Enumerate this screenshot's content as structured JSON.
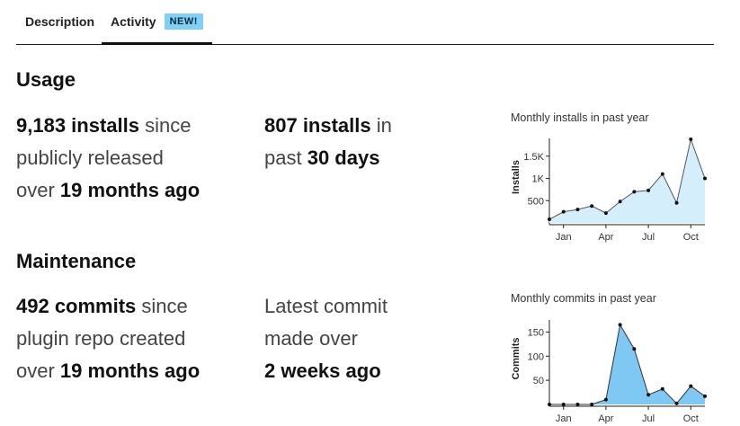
{
  "tabs": {
    "description_label": "Description",
    "activity_label": "Activity",
    "badge_label": "NEW!"
  },
  "usage": {
    "title": "Usage",
    "stat1": {
      "count": "9,183 installs",
      "t1": "since",
      "t2": "publicly released",
      "t3": "over",
      "period": "19 months ago"
    },
    "stat2": {
      "count": "807 installs",
      "t1": "in",
      "t2": "past",
      "period": "30 days"
    }
  },
  "maintenance": {
    "title": "Maintenance",
    "stat1": {
      "count": "492 commits",
      "t1": "since",
      "t2": "plugin repo created",
      "t3": "over",
      "period": "19 months ago"
    },
    "stat2": {
      "t1": "Latest commit",
      "t2": "made",
      "t3": "over",
      "period": "2 weeks ago"
    }
  },
  "chart_data": [
    {
      "type": "area",
      "title": "Monthly installs in past year",
      "ylabel": "Installs",
      "xticks": [
        "Jan",
        "Apr",
        "Jul",
        "Oct"
      ],
      "yticks": [
        500,
        1000,
        1500
      ],
      "ytick_labels": [
        "500",
        "1K",
        "1.5K"
      ],
      "ylim": [
        0,
        1900
      ],
      "values": [
        80,
        250,
        300,
        380,
        220,
        480,
        700,
        730,
        1100,
        450,
        1880,
        1000
      ],
      "fill_color": "#d4eefb",
      "line_color": "#555555"
    },
    {
      "type": "area",
      "title": "Monthly commits in past year",
      "ylabel": "Commits",
      "xticks": [
        "Jan",
        "Apr",
        "Jul",
        "Oct"
      ],
      "yticks": [
        50,
        100,
        150
      ],
      "ytick_labels": [
        "50",
        "100",
        "150"
      ],
      "ylim": [
        0,
        175
      ],
      "values": [
        0,
        0,
        0,
        0,
        10,
        165,
        115,
        20,
        32,
        2,
        38,
        17
      ],
      "fill_color": "#7ec8f3",
      "line_color": "#333333"
    }
  ]
}
